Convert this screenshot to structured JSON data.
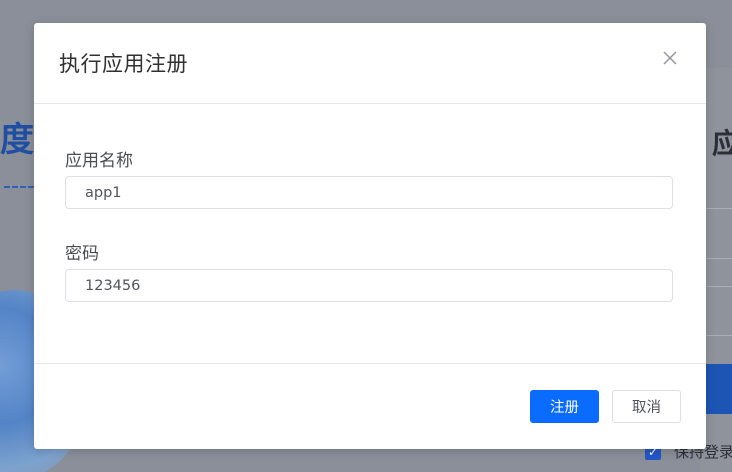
{
  "background": {
    "left_title_glyph": "度",
    "right_title_glyph": "应",
    "keep_login_label": "保持登录"
  },
  "dialog": {
    "title": "执行应用注册",
    "fields": [
      {
        "label": "应用名称",
        "value": "app1"
      },
      {
        "label": "密码",
        "value": "123456"
      }
    ],
    "buttons": {
      "register_label": "注册",
      "cancel_label": "取消"
    }
  },
  "colors": {
    "primary": "#0a6cff",
    "overlay": "#8a8f99"
  }
}
